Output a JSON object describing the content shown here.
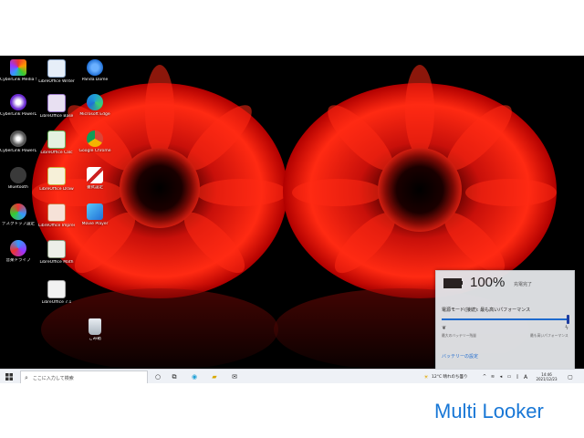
{
  "desktop": {
    "icons": [
      {
        "label": "CyberLink Media Suite 10",
        "icon": "cyberlink-media-suite-icon",
        "color": "#2c2c2c"
      },
      {
        "label": "LibreOffice Writer",
        "icon": "libreoffice-writer-icon",
        "color": "#e6eef8"
      },
      {
        "label": "Panda Dome",
        "icon": "panda-dome-icon",
        "color": "#1f6fd6"
      },
      {
        "label": "CyberLink PowerDVD 12",
        "icon": "powerdvd-icon",
        "color": "#6a2ad0"
      },
      {
        "label": "LibreOffice Base",
        "icon": "libreoffice-base-icon",
        "color": "#e8e0f2"
      },
      {
        "label": "Microsoft Edge",
        "icon": "edge-icon",
        "color": "#1fa0d6"
      },
      {
        "label": "CyberLink PowerDirector",
        "icon": "powerdirector-icon",
        "color": "#333333"
      },
      {
        "label": "LibreOffice Calc",
        "icon": "libreoffice-calc-icon",
        "color": "#e4f2e0"
      },
      {
        "label": "Google Chrome",
        "icon": "chrome-icon",
        "color": "#db4437"
      },
      {
        "label": "Bluetooth",
        "icon": "bluetooth-icon",
        "color": "#3a3a3a"
      },
      {
        "label": "LibreOffice Draw",
        "icon": "libreoffice-draw-icon",
        "color": "#f6f0d8"
      },
      {
        "label": "書式設定",
        "icon": "pen-tool-icon",
        "color": "#f0f0f0"
      },
      {
        "label": "デスクトップ設定",
        "icon": "desktop-settings-icon",
        "color": "#2a2a2a"
      },
      {
        "label": "LibreOffice Impress",
        "icon": "libreoffice-impress-icon",
        "color": "#f6e2d8"
      },
      {
        "label": "Movie Player",
        "icon": "movie-player-icon",
        "color": "#2a8ae0"
      },
      {
        "label": "音楽ドライブ",
        "icon": "music-drive-icon",
        "color": "#2a2a2a"
      },
      {
        "label": "LibreOffice Math",
        "icon": "libreoffice-math-icon",
        "color": "#ecefe8"
      },
      {
        "label": "",
        "icon": "",
        "color": ""
      },
      {
        "label": "",
        "icon": "",
        "color": ""
      },
      {
        "label": "LibreOffice 7.1",
        "icon": "libreoffice-icon",
        "color": "#f2f2f2"
      },
      {
        "label": "",
        "icon": "",
        "color": ""
      },
      {
        "label": "",
        "icon": "",
        "color": ""
      },
      {
        "label": "",
        "icon": "",
        "color": ""
      },
      {
        "label": "ごみ箱",
        "icon": "recycle-bin-icon",
        "color": "#cfd6de"
      }
    ]
  },
  "taskbar": {
    "search_placeholder": "ここに入力して検索",
    "weather": "12°C 晴れのち曇り",
    "tray_lang": "A",
    "time": "14:46",
    "date": "2021/12/23"
  },
  "battery_panel": {
    "percent": "100%",
    "status": "充電完了",
    "mode_label": "電源モード(接続): 最も高いパフォーマンス",
    "left_label": "最大のバッテリー残量",
    "right_label": "最も高いパフォーマンス",
    "slider_value": 1.0,
    "settings_link": "バッテリーの設定",
    "accent": "#1f6fd6"
  },
  "brand": {
    "name": "Multi Looker"
  }
}
